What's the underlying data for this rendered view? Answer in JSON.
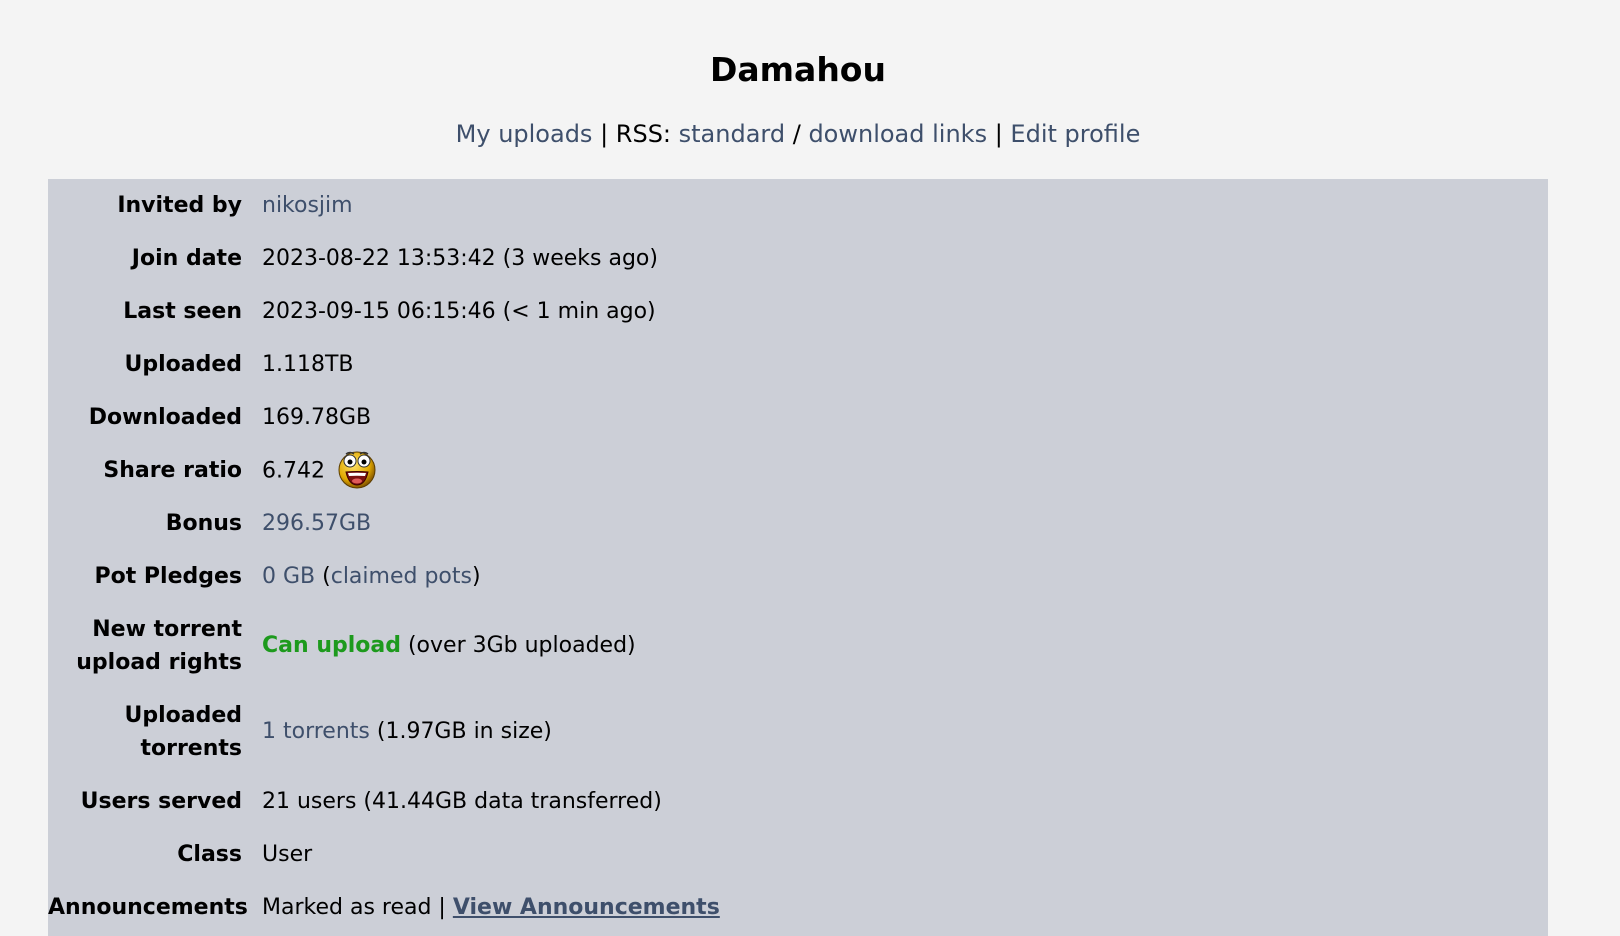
{
  "header": {
    "title": "Damahou",
    "links": {
      "my_uploads": "My uploads",
      "sep1": " | RSS: ",
      "standard": "standard",
      "slash": " / ",
      "download_links": "download links",
      "sep2": " | ",
      "edit_profile": "Edit profile"
    }
  },
  "profile": {
    "invited_by": {
      "label": "Invited by",
      "value": "nikosjim"
    },
    "join_date": {
      "label": "Join date",
      "value": "2023-08-22 13:53:42 (3 weeks ago)"
    },
    "last_seen": {
      "label": "Last seen",
      "value": "2023-09-15 06:15:46 (< 1 min ago)"
    },
    "uploaded": {
      "label": "Uploaded",
      "value": "1.118TB"
    },
    "downloaded": {
      "label": "Downloaded",
      "value": "169.78GB"
    },
    "share_ratio": {
      "label": "Share ratio",
      "value": "6.742",
      "icon": "smiley-face-icon"
    },
    "bonus": {
      "label": "Bonus",
      "value": "296.57GB"
    },
    "pot_pledges": {
      "label": "Pot Pledges",
      "value": "0 GB",
      "open": " (",
      "claimed": "claimed pots",
      "close": ")"
    },
    "upload_rights": {
      "label_line1": "New torrent",
      "label_line2": "upload rights",
      "status": "Can upload",
      "note": " (over 3Gb uploaded)"
    },
    "uploaded_torrents": {
      "label_line1": "Uploaded",
      "label_line2": "torrents",
      "link": "1 torrents",
      "note": " (1.97GB in size)"
    },
    "users_served": {
      "label": "Users served",
      "value": "21 users (41.44GB data transferred)"
    },
    "class": {
      "label": "Class",
      "value": "User"
    },
    "announcements": {
      "label": "Announcements",
      "status": "Marked as read | ",
      "link": "View Announcements"
    }
  },
  "colors": {
    "link": "#3e4f6b",
    "green": "#1d9a1d",
    "panel": "#cccfd7",
    "background": "#f4f4f4"
  }
}
